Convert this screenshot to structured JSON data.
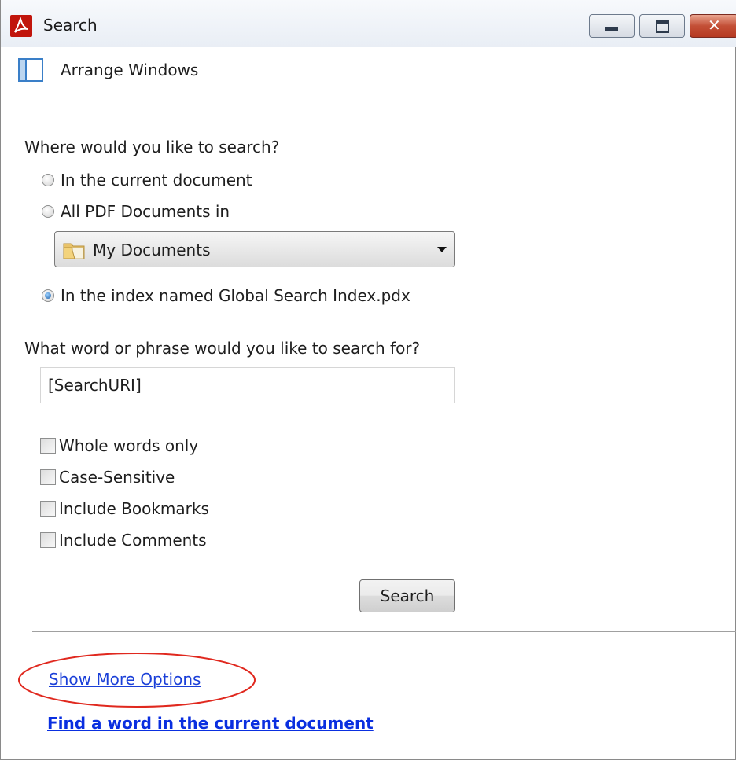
{
  "window": {
    "title": "Search",
    "controls": {
      "minimize": "minimize",
      "maximize": "maximize",
      "close": "✕"
    }
  },
  "arrange_windows": {
    "label": "Arrange Windows"
  },
  "where": {
    "question": "Where would you like to search?",
    "options": [
      {
        "label": "In the current document",
        "checked": false
      },
      {
        "label": "All PDF Documents in",
        "checked": false
      },
      {
        "label": "In the index named Global Search Index.pdx",
        "checked": true
      }
    ],
    "location_dropdown": {
      "selected": "My Documents"
    }
  },
  "what": {
    "question": "What word or phrase would you like to search for?",
    "value": "[SearchURI]"
  },
  "checkboxes": [
    {
      "label": "Whole words only",
      "checked": false
    },
    {
      "label": "Case-Sensitive",
      "checked": false
    },
    {
      "label": "Include Bookmarks",
      "checked": false
    },
    {
      "label": "Include Comments",
      "checked": false
    }
  ],
  "search_button": {
    "label": "Search"
  },
  "links": {
    "show_more_options": "Show More Options",
    "find_word": "Find a word in the current document"
  },
  "colors": {
    "link": "#1a3fd8",
    "highlight": "#e0281e",
    "radio_selected": "#1f5fa6"
  }
}
